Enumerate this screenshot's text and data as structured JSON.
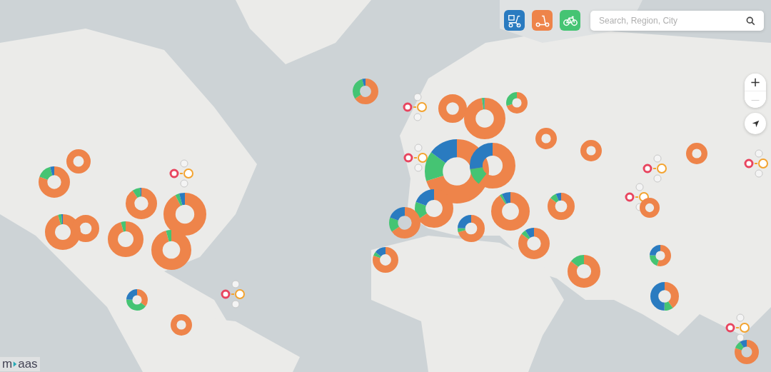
{
  "mode_buttons": [
    {
      "kind": "delivery",
      "color": "#2a7bc0"
    },
    {
      "kind": "scooter",
      "color": "#ee844a"
    },
    {
      "kind": "bike",
      "color": "#45c473"
    }
  ],
  "search": {
    "placeholder": "Search, Region, City"
  },
  "zoom_controls": [
    {
      "label": "+",
      "disabled": false
    },
    {
      "label": "—",
      "disabled": true
    }
  ],
  "logo": {
    "start": "m",
    "end": "aas"
  }
}
